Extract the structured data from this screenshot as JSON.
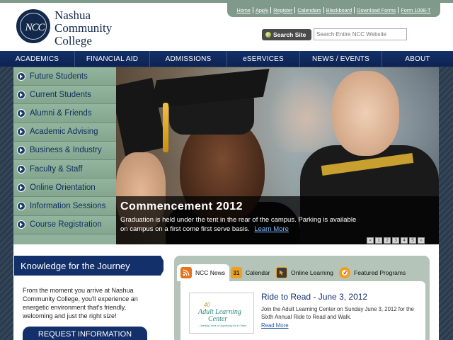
{
  "header": {
    "logo_initials": "NCC",
    "logo_lines": [
      "Nashua",
      "Community",
      "College"
    ],
    "utility_links": [
      "Home",
      "Apply",
      "Register",
      "Calendars",
      "Blackboard",
      "Download Forms",
      "Form 1098-T"
    ],
    "search_button": "Search Site",
    "search_placeholder": "Search Entire NCC Website"
  },
  "nav": {
    "items": [
      "ACADEMICS",
      "FINANCIAL AID",
      "ADMISSIONS",
      "eSERVICES",
      "NEWS / EVENTS",
      "ABOUT"
    ]
  },
  "sidebar": {
    "items": [
      "Future Students",
      "Current Students",
      "Alumni & Friends",
      "Academic Advising",
      "Business & Industry",
      "Faculty & Staff",
      "Online Orientation",
      "Information Sessions",
      "Course Registration"
    ]
  },
  "hero": {
    "title": "Commencement 2012",
    "description": "Graduation is held under the tent in the rear of the campus. Parking is available on campus on a first come first serve basis.",
    "link": "Learn More",
    "pager": [
      "«",
      "1",
      "2",
      "3",
      "4",
      "5",
      "»"
    ]
  },
  "knowledge": {
    "heading": "Knowledge for the Journey",
    "body": "From the moment you arrive at Nashua Community College, you'll experience an energetic environment that's friendly, welcoming and just the right size!",
    "button": "REQUEST INFORMATION"
  },
  "tabs": {
    "items": [
      "NCC News",
      "Calendar",
      "Online Learning",
      "Featured Programs"
    ],
    "calendar_day": "31"
  },
  "news": {
    "image_number": "40",
    "image_lines": [
      "Adult Learning",
      "Center"
    ],
    "image_tagline": "Opening Doors of Opportunity for 40 Years",
    "title": "Ride to Read - June 3, 2012",
    "text": "Join the Adult Learning Center on Sunday June 3, 2012 for the Sixth Annual Ride to Read and Walk.",
    "more": "Read More"
  }
}
